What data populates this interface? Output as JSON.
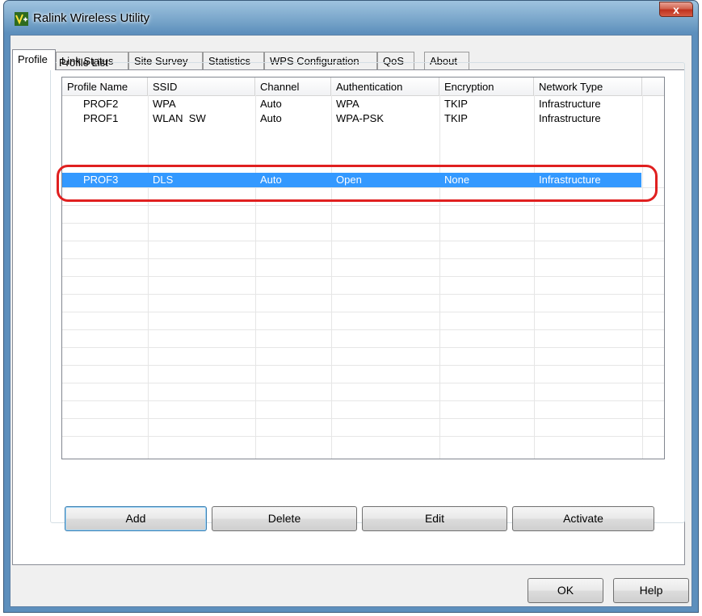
{
  "window": {
    "title": "Ralink Wireless Utility",
    "close_glyph": "x",
    "accent_color": "#3399ff",
    "highlight_color": "#e02020"
  },
  "tabs": [
    {
      "label": "Profile",
      "active": true
    },
    {
      "label": "Link Status"
    },
    {
      "label": "Site Survey"
    },
    {
      "label": "Statistics"
    },
    {
      "label": "WPS Configuration"
    },
    {
      "label": "QoS"
    },
    {
      "label": "About"
    }
  ],
  "profile_list": {
    "group_label": "Profile List",
    "columns": [
      "Profile Name",
      "SSID",
      "Channel",
      "Authentication",
      "Encryption",
      "Network Type"
    ],
    "rows": [
      {
        "profile": "PROF2",
        "ssid": "WPA",
        "channel": "Auto",
        "auth": "WPA",
        "enc": "TKIP",
        "type": "Infrastructure"
      },
      {
        "profile": "PROF1",
        "ssid": "WLAN_SW",
        "channel": "Auto",
        "auth": "WPA-PSK",
        "enc": "TKIP",
        "type": "Infrastructure"
      },
      {
        "profile": "PROF3",
        "ssid": "DLS",
        "channel": "Auto",
        "auth": "Open",
        "enc": "None",
        "type": "Infrastructure",
        "selected": true
      }
    ]
  },
  "buttons": {
    "add": "Add",
    "delete": "Delete",
    "edit": "Edit",
    "activate": "Activate",
    "ok": "OK",
    "help": "Help"
  }
}
